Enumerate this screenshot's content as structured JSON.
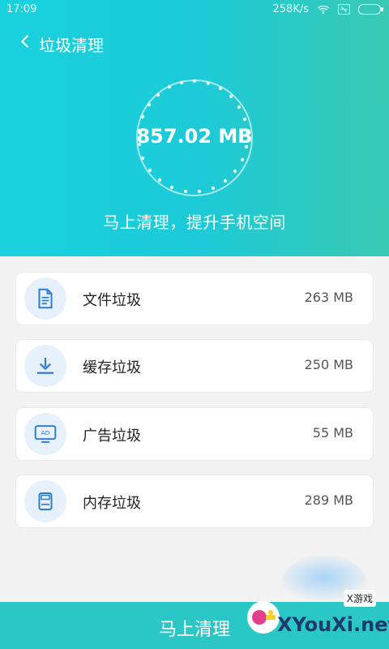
{
  "status": {
    "time": "17:09",
    "net": "258K/s"
  },
  "header": {
    "title": "垃圾清理",
    "total_size": "857.02 MB",
    "tagline": "马上清理，提升手机空间"
  },
  "items": [
    {
      "label": "文件垃圾",
      "value": "263 MB",
      "icon": "document-icon"
    },
    {
      "label": "缓存垃圾",
      "value": "250 MB",
      "icon": "download-icon"
    },
    {
      "label": "广告垃圾",
      "value": "55 MB",
      "icon": "ad-monitor-icon"
    },
    {
      "label": "内存垃圾",
      "value": "289 MB",
      "icon": "memory-card-icon"
    }
  ],
  "cta": {
    "label": "马上清理"
  },
  "watermark": {
    "brand": "XYouXi.net",
    "small": "X游戏"
  },
  "colors": {
    "teal": "#1ccad8",
    "teal_green": "#39c9b3",
    "blue": "#2f7dd1",
    "chip_bg": "#e7f1fb"
  }
}
